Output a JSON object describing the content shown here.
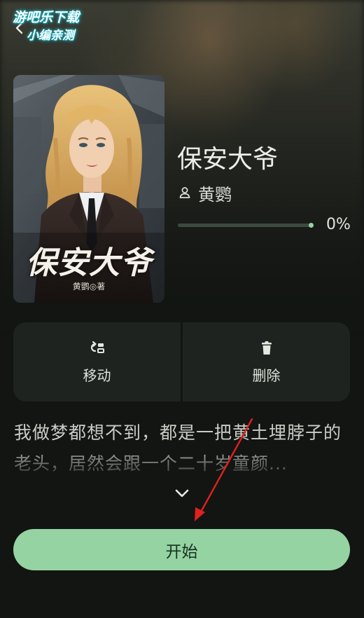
{
  "watermark": {
    "line1": "游吧乐下载",
    "line2": "小编亲测"
  },
  "book": {
    "title": "保安大爷",
    "author": "黄鹦",
    "progress_label": "0%",
    "progress": 0
  },
  "cover": {
    "title_art": "保安大爷",
    "author_art": "黄鹦◎著"
  },
  "actions": {
    "move_label": "移动",
    "delete_label": "删除"
  },
  "description": {
    "text": "我做梦都想不到，都是一把黄土埋脖子的老头，居然会跟一个二十岁童颜..."
  },
  "start_button": {
    "label": "开始"
  },
  "icons": {
    "back": "back-arrow-icon",
    "author": "person-icon",
    "move": "move-icon",
    "delete": "trash-icon",
    "expand": "chevron-down-icon"
  },
  "colors": {
    "background": "#121512",
    "accent": "#96d3a3",
    "card": "#1e231f",
    "annotation": "#e0211f"
  }
}
